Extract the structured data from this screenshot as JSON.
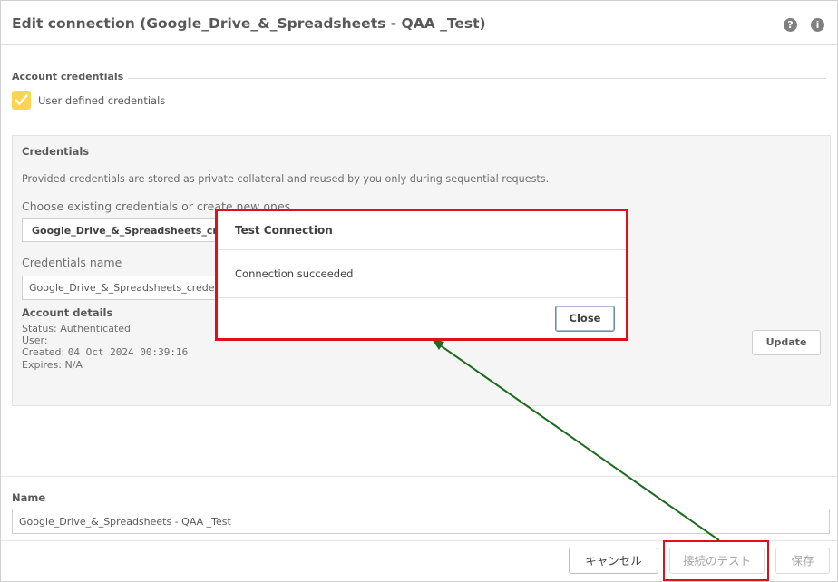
{
  "window": {
    "title": "Edit connection (Google_Drive_&_Spreadsheets - QAA _Test)",
    "help_icon": "question-circle-icon",
    "info_icon": "info-circle-icon"
  },
  "account_credentials": {
    "section_label": "Account credentials",
    "user_defined_label": "User defined credentials",
    "user_defined_checked": true
  },
  "credentials": {
    "title": "Credentials",
    "description": "Provided credentials are stored as private collateral and reused by you only during sequential requests.",
    "choose_label": "Choose existing credentials or create new ones",
    "selected_value": "Google_Drive_&_Spreadsheets_cre",
    "name_label": "Credentials name",
    "name_value": "Google_Drive_&_Spreadsheets_crede",
    "account_details_title": "Account details",
    "status": "Status: Authenticated",
    "user": "User:",
    "created_label": "Created:",
    "created_value": "04 Oct 2024 00:39:16",
    "expires": "Expires: N/A",
    "update_button": "Update"
  },
  "name": {
    "label": "Name",
    "value": "Google_Drive_&_Spreadsheets - QAA _Test"
  },
  "footer": {
    "cancel": "キャンセル",
    "test_connection": "接続のテスト",
    "save": "保存"
  },
  "modal": {
    "title": "Test Connection",
    "message": "Connection succeeded",
    "close": "Close"
  },
  "colors": {
    "checkbox": "#ffd452",
    "highlight": "#e0101a",
    "arrow": "#1e6b1e"
  }
}
